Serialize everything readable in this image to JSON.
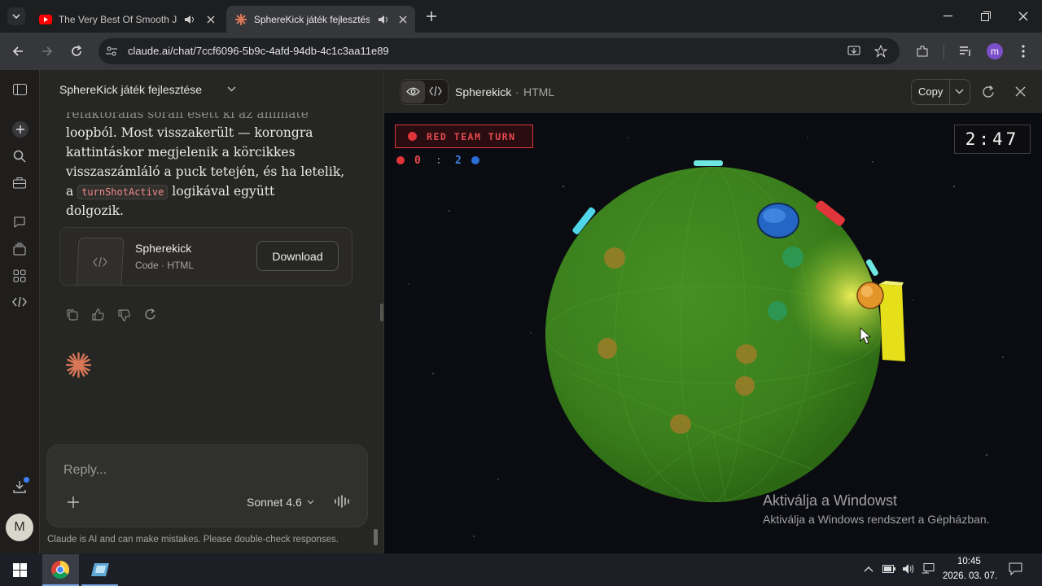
{
  "browser": {
    "tabs": [
      {
        "title": "The Very Best Of Smooth Ja",
        "favicon": "youtube-icon"
      },
      {
        "title": "SphereKick játék fejlesztése",
        "favicon": "claude-icon"
      }
    ],
    "url": "claude.ai/chat/7ccf6096-5b9c-4afd-94db-4c1c3aa11e89",
    "profile_initial": "m"
  },
  "chat": {
    "title": "SphereKick játék fejlesztése",
    "message_lines": [
      "refaktorálás során esett ki az animate",
      "loopból. Most visszakerült — korongra",
      "kattintáskor megjelenik a körcikkes",
      "visszaszámláló a puck tetején, és ha letelik,"
    ],
    "line5_prefix": "a",
    "line5_code": "turnShotActive",
    "line5_suffix": "logikával együtt",
    "line6": "dolgozik.",
    "artifact_name": "Spherekick",
    "artifact_meta": "Code · HTML",
    "download_label": "Download",
    "reply_placeholder": "Reply...",
    "model": "Sonnet 4.6",
    "disclaimer": "Claude is AI and can make mistakes. Please double-check responses.",
    "user_initial": "M"
  },
  "panel": {
    "title": "Spherekick",
    "separator": "·",
    "subtitle": "HTML",
    "copy_label": "Copy"
  },
  "game": {
    "turn_label": "RED TEAM TURN",
    "red_score": "0",
    "score_sep": ":",
    "blue_score": "2",
    "timer": "2:47",
    "colors": {
      "red": "#e0353b",
      "blue": "#2b6fd6",
      "field": "#3d8a1e"
    }
  },
  "windows_watermark": {
    "line1": "Aktiválja a Windowst",
    "line2": "Aktiválja a Windows rendszert a Gépházban."
  },
  "taskbar": {
    "time": "10:45",
    "date": "2026. 03. 07."
  }
}
